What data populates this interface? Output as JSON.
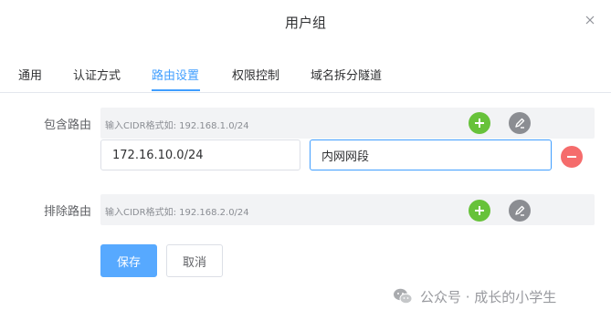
{
  "dialog": {
    "title": "用户组"
  },
  "tabs": [
    {
      "label": "通用",
      "active": false
    },
    {
      "label": "认证方式",
      "active": false
    },
    {
      "label": "路由设置",
      "active": true
    },
    {
      "label": "权限控制",
      "active": false
    },
    {
      "label": "域名拆分隧道",
      "active": false
    }
  ],
  "include_routes": {
    "label": "包含路由",
    "placeholder": "输入CIDR格式如: 192.168.1.0/24",
    "entry": {
      "cidr": "172.16.10.0/24",
      "description": "内网网段"
    }
  },
  "exclude_routes": {
    "label": "排除路由",
    "placeholder": "输入CIDR格式如: 192.168.2.0/24"
  },
  "actions": {
    "save_label": "保存",
    "cancel_label": "取消"
  },
  "watermark": {
    "text": "公众号 · 成长的小学生"
  },
  "colors": {
    "accent": "#409eff",
    "add": "#67c23a",
    "edit": "#8b8d92",
    "remove": "#f56c6c"
  },
  "icons": {
    "close": "close-icon",
    "add": "plus-icon",
    "edit": "edit-pencil-icon",
    "remove": "minus-icon",
    "watermark": "wechat-icon"
  }
}
